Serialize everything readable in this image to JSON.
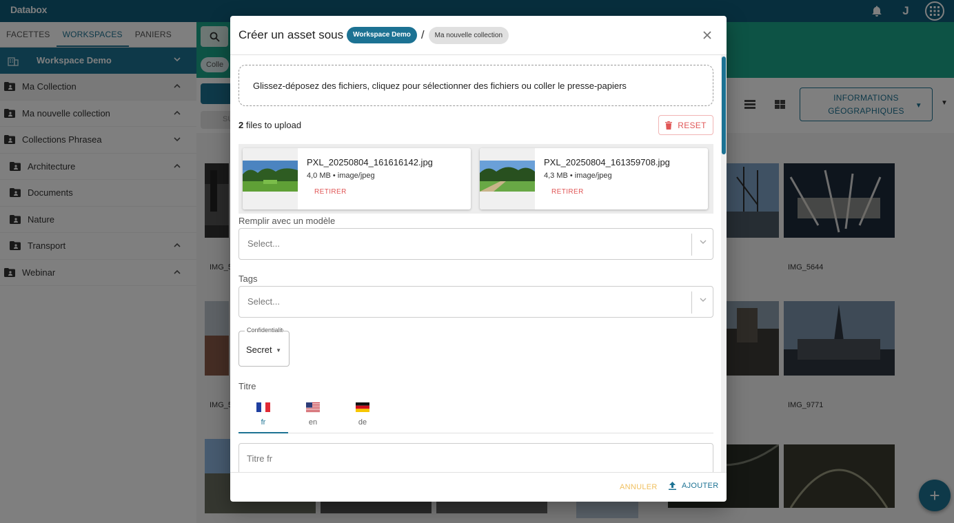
{
  "app": {
    "brand": "Databox",
    "user_initial": "J"
  },
  "sidebar": {
    "tabs": [
      {
        "label": "Facettes"
      },
      {
        "label": "Workspaces"
      },
      {
        "label": "Paniers"
      }
    ],
    "workspace": "Workspace Demo",
    "collections": [
      {
        "label": "Ma Collection"
      },
      {
        "label": "Ma nouvelle collection"
      },
      {
        "label": "Collections Phrasea"
      },
      {
        "label": "Architecture"
      },
      {
        "label": "Documents"
      },
      {
        "label": "Nature"
      },
      {
        "label": "Transport"
      },
      {
        "label": "Webinar"
      }
    ]
  },
  "main": {
    "chip": "Colle",
    "geo_button": "Informations géographiques",
    "toolbar_partial": "SU",
    "grid_labels": [
      "IMG_5",
      "IMG_5644",
      "IMG_5",
      "IMG_9771"
    ]
  },
  "dialog": {
    "title": "Créer un asset sous",
    "workspace_chip": "Workspace Demo",
    "separator": "/",
    "collection_chip": "Ma nouvelle collection",
    "dropzone": "Glissez-déposez des fichiers, cliquez pour sélectionner des fichiers ou coller le presse-papiers",
    "upload_count": "2",
    "upload_suffix": "files to upload",
    "reset_label": "Reset",
    "files": [
      {
        "name": "PXL_20250804_161616142.jpg",
        "meta": "4,0 MB • image/jpeg",
        "remove": "Retirer"
      },
      {
        "name": "PXL_20250804_161359708.jpg",
        "meta": "4,3 MB • image/jpeg",
        "remove": "Retirer"
      }
    ],
    "template_label": "Remplir avec un modèle",
    "template_placeholder": "Select...",
    "tags_label": "Tags",
    "tags_placeholder": "Select...",
    "confidentiality_label": "Confidentialité",
    "confidentiality_value": "Secret",
    "titre_label": "Titre",
    "languages": [
      {
        "code": "fr"
      },
      {
        "code": "en"
      },
      {
        "code": "de"
      }
    ],
    "titre_placeholder": "Titre fr",
    "cancel_label": "Annuler",
    "add_label": "Ajouter"
  }
}
